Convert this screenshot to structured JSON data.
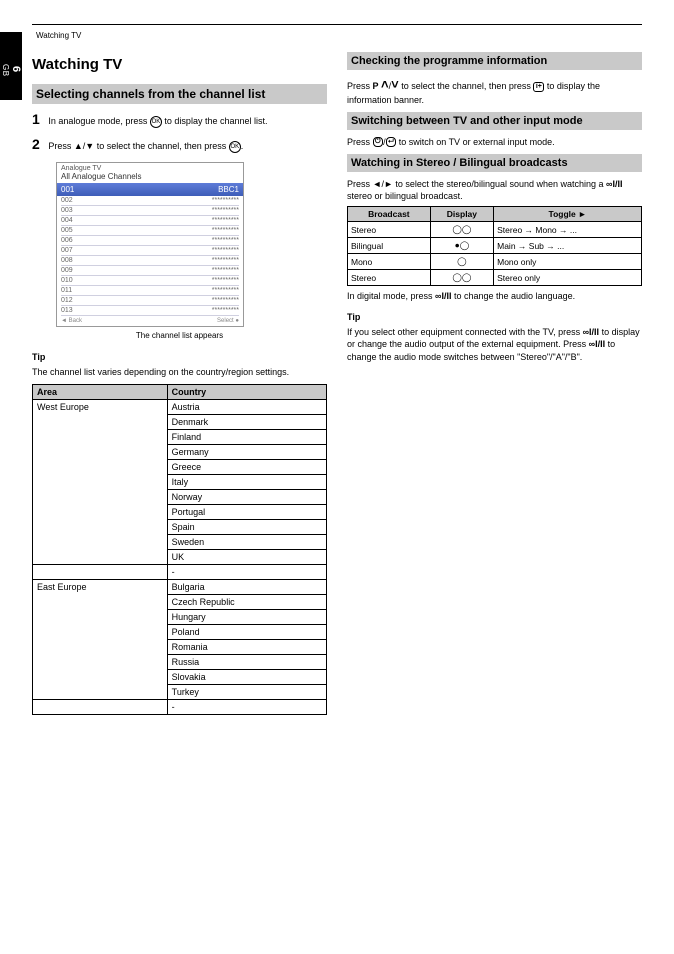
{
  "page": {
    "number": "6",
    "side_label": "GB",
    "header": "Watching TV"
  },
  "left": {
    "h1": "Watching TV",
    "band_title": "Selecting channels from the channel list",
    "step1_a": "In analogue mode, press",
    "step1_b": " to display the channel list.",
    "step2_a": "Press ",
    "step2_b": " to select the channel, then press ",
    "step2_tail": ".",
    "caption": "The channel list appears",
    "menu": {
      "title": "Analogue TV",
      "sub": "All Analogue Channels",
      "sel_num": "001",
      "sel_name": "BBC1",
      "rows": [
        {
          "n": "002",
          "name": "**********"
        },
        {
          "n": "003",
          "name": "**********"
        },
        {
          "n": "004",
          "name": "**********"
        },
        {
          "n": "005",
          "name": "**********"
        },
        {
          "n": "006",
          "name": "**********"
        },
        {
          "n": "007",
          "name": "**********"
        },
        {
          "n": "008",
          "name": "**********"
        },
        {
          "n": "009",
          "name": "**********"
        },
        {
          "n": "010",
          "name": "**********"
        },
        {
          "n": "011",
          "name": "**********"
        },
        {
          "n": "012",
          "name": "**********"
        },
        {
          "n": "013",
          "name": "**********"
        }
      ],
      "foot_left": "Back",
      "foot_right": "Select"
    },
    "tip_label": "Tip",
    "tip_text": "The channel list varies depending on the country/region settings.",
    "table": {
      "hdr_area": "Area",
      "hdr_country": "Country",
      "rows": [
        {
          "area": "West Europe",
          "items": [
            "Austria",
            "Denmark",
            "Finland",
            "Germany",
            "Greece",
            "Italy",
            "Norway",
            "Portugal",
            "Spain",
            "Sweden",
            "UK"
          ]
        },
        {
          "area": "",
          "items": [
            "-"
          ]
        },
        {
          "area": "East Europe",
          "items": [
            "Bulgaria",
            "Czech Republic",
            "Hungary",
            "Poland",
            "Romania",
            "Russia",
            "Slovakia",
            "Turkey"
          ]
        },
        {
          "area": "",
          "items": [
            "-"
          ]
        }
      ]
    }
  },
  "right": {
    "band1": "Checking the programme information",
    "p1_a": "Press ",
    "p1_b": " to select the channel, then press ",
    "p1_c": " to display the information banner.",
    "band2": "Switching between TV and other input mode",
    "p2_a": "Press ",
    "p2_b": " to switch on TV or external input mode.",
    "band3": "Watching in Stereo / Bilingual broadcasts",
    "p3_a": "Press ",
    "p3_b": " to select the stereo/bilingual sound when watching a ",
    "p3_c": " stereo or bilingual broadcast.",
    "stereo_table": {
      "hdr_broadcast": "Broadcast",
      "hdr_display": "Display",
      "hdr_toggle": "Toggle",
      "rows": [
        {
          "broadcast": "Stereo",
          "display": "stereo_icon",
          "toggle": "Stereo → Mono → ..."
        },
        {
          "broadcast": "Bilingual",
          "display": "bilingual_icon",
          "toggle": "Main → Sub → ..."
        },
        {
          "broadcast": "Mono",
          "display": "mono_icon",
          "toggle": "Mono only"
        },
        {
          "broadcast": "Stereo",
          "display": "stereo2_icon",
          "toggle": "Stereo only"
        }
      ]
    },
    "after1_a": "In digital mode, press ",
    "after1_b": " to change the audio language.",
    "tip_label": "Tip",
    "tip_a": "If you select other equipment connected with the TV, press ",
    "tip_b": " to display or change the audio output of the external equipment. Press ",
    "tip_c": " to change the audio mode switches between \"Stereo\"/\"A\"/\"B\"."
  }
}
